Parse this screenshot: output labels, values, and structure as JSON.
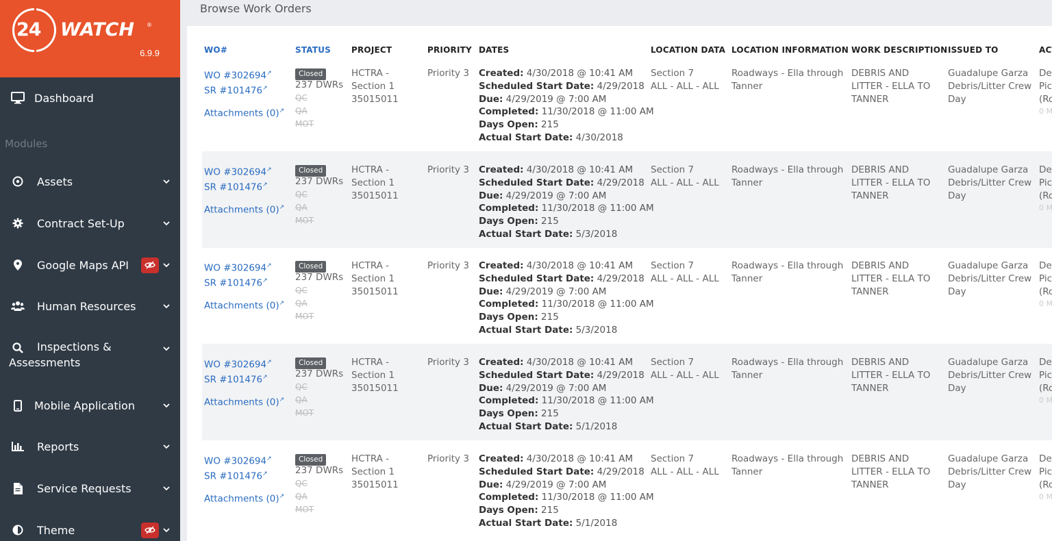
{
  "brand": {
    "logo_num": "24",
    "logo_word": "WATCH",
    "logo_reg": "®",
    "version": "6.9.9"
  },
  "sidebar": {
    "dashboard": "Dashboard",
    "modules_label": "Modules",
    "items": [
      {
        "label": "Assets",
        "icon": "compass-icon",
        "badge": false
      },
      {
        "label": "Contract Set-Up",
        "icon": "gear-icon",
        "badge": false
      },
      {
        "label": "Google Maps API",
        "icon": "map-marker-icon",
        "badge": true
      },
      {
        "label": "Human Resources",
        "icon": "users-icon",
        "badge": false
      },
      {
        "label": "Inspections &",
        "label2": "Assessments",
        "icon": "search-icon",
        "badge": false
      },
      {
        "label": "Mobile Application",
        "icon": "mobile-icon",
        "badge": false
      },
      {
        "label": "Reports",
        "icon": "bar-chart-icon",
        "badge": false
      },
      {
        "label": "Service Requests",
        "icon": "file-icon",
        "badge": false
      },
      {
        "label": "Theme",
        "icon": "contrast-icon",
        "badge": true
      }
    ]
  },
  "page": {
    "title": "Browse Work Orders"
  },
  "table": {
    "headers": {
      "wo": "WO#",
      "status": "STATUS",
      "project": "PROJECT",
      "priority": "PRIORITY",
      "dates": "DATES",
      "location_data": "LOCATION DATA",
      "location_info": "LOCATION INFORMATION",
      "work_desc": "WORK DESCRIPTION",
      "issued_to": "ISSUED TO",
      "actions": "ACT"
    },
    "rows": [
      {
        "wo": "WO #302694",
        "sr": "SR #101476",
        "attachments": "Attachments (0)",
        "status": "Closed",
        "dwrs": "237 DWRs",
        "qc": "QC",
        "qa": "QA",
        "mot": "MOT",
        "project1": "HCTRA -",
        "project2": "Section 1",
        "project3": "35015011",
        "priority": "Priority 3",
        "created_label": "Created:",
        "created": " 4/30/2018 @ 10:41 AM",
        "sched_label": "Scheduled Start Date:",
        "sched": " 4/29/2018",
        "due_label": "Due:",
        "due": " 4/29/2019 @ 7:00 AM",
        "completed_label": "Completed:",
        "completed": " 11/30/2018 @ 11:00 AM",
        "days_label": "Days Open:",
        "days": " 215",
        "actual_label": "Actual Start Date:",
        "actual": " 4/30/2018",
        "loc1": "Section 7",
        "loc2": "ALL - ALL - ALL",
        "info1": "Roadways - Ella through",
        "info2": "Tanner",
        "desc1": "DEBRIS AND",
        "desc2": "LITTER - ELLA TO",
        "desc3": "TANNER",
        "issued1": "Guadalupe Garza",
        "issued2": "Debris/Litter Crew",
        "issued3": "Day",
        "act1": "De",
        "act2": "Pic",
        "act3": "(Ro",
        "act4": "0 M"
      },
      {
        "wo": "WO #302694",
        "sr": "SR #101476",
        "attachments": "Attachments (0)",
        "status": "Closed",
        "dwrs": "237 DWRs",
        "qc": "QC",
        "qa": "QA",
        "mot": "MOT",
        "project1": "HCTRA -",
        "project2": "Section 1",
        "project3": "35015011",
        "priority": "Priority 3",
        "created_label": "Created:",
        "created": " 4/30/2018 @ 10:41 AM",
        "sched_label": "Scheduled Start Date:",
        "sched": " 4/29/2018",
        "due_label": "Due:",
        "due": " 4/29/2019 @ 7:00 AM",
        "completed_label": "Completed:",
        "completed": " 11/30/2018 @ 11:00 AM",
        "days_label": "Days Open:",
        "days": " 215",
        "actual_label": "Actual Start Date:",
        "actual": " 5/3/2018",
        "loc1": "Section 7",
        "loc2": "ALL - ALL - ALL",
        "info1": "Roadways - Ella through",
        "info2": "Tanner",
        "desc1": "DEBRIS AND",
        "desc2": "LITTER - ELLA TO",
        "desc3": "TANNER",
        "issued1": "Guadalupe Garza",
        "issued2": "Debris/Litter Crew",
        "issued3": "Day",
        "act1": "De",
        "act2": "Pic",
        "act3": "(Ro",
        "act4": "0 M"
      },
      {
        "wo": "WO #302694",
        "sr": "SR #101476",
        "attachments": "Attachments (0)",
        "status": "Closed",
        "dwrs": "237 DWRs",
        "qc": "QC",
        "qa": "QA",
        "mot": "MOT",
        "project1": "HCTRA -",
        "project2": "Section 1",
        "project3": "35015011",
        "priority": "Priority 3",
        "created_label": "Created:",
        "created": " 4/30/2018 @ 10:41 AM",
        "sched_label": "Scheduled Start Date:",
        "sched": " 4/29/2018",
        "due_label": "Due:",
        "due": " 4/29/2019 @ 7:00 AM",
        "completed_label": "Completed:",
        "completed": " 11/30/2018 @ 11:00 AM",
        "days_label": "Days Open:",
        "days": " 215",
        "actual_label": "Actual Start Date:",
        "actual": " 5/3/2018",
        "loc1": "Section 7",
        "loc2": "ALL - ALL - ALL",
        "info1": "Roadways - Ella through",
        "info2": "Tanner",
        "desc1": "DEBRIS AND",
        "desc2": "LITTER - ELLA TO",
        "desc3": "TANNER",
        "issued1": "Guadalupe Garza",
        "issued2": "Debris/Litter Crew",
        "issued3": "Day",
        "act1": "De",
        "act2": "Pic",
        "act3": "(Ro",
        "act4": "0 M"
      },
      {
        "wo": "WO #302694",
        "sr": "SR #101476",
        "attachments": "Attachments (0)",
        "status": "Closed",
        "dwrs": "237 DWRs",
        "qc": "QC",
        "qa": "QA",
        "mot": "MOT",
        "project1": "HCTRA -",
        "project2": "Section 1",
        "project3": "35015011",
        "priority": "Priority 3",
        "created_label": "Created:",
        "created": " 4/30/2018 @ 10:41 AM",
        "sched_label": "Scheduled Start Date:",
        "sched": " 4/29/2018",
        "due_label": "Due:",
        "due": " 4/29/2019 @ 7:00 AM",
        "completed_label": "Completed:",
        "completed": " 11/30/2018 @ 11:00 AM",
        "days_label": "Days Open:",
        "days": " 215",
        "actual_label": "Actual Start Date:",
        "actual": " 5/1/2018",
        "loc1": "Section 7",
        "loc2": "ALL - ALL - ALL",
        "info1": "Roadways - Ella through",
        "info2": "Tanner",
        "desc1": "DEBRIS AND",
        "desc2": "LITTER - ELLA TO",
        "desc3": "TANNER",
        "issued1": "Guadalupe Garza",
        "issued2": "Debris/Litter Crew",
        "issued3": "Day",
        "act1": "De",
        "act2": "Pic",
        "act3": "(Ro",
        "act4": "0 M"
      },
      {
        "wo": "WO #302694",
        "sr": "SR #101476",
        "attachments": "Attachments (0)",
        "status": "Closed",
        "dwrs": "237 DWRs",
        "qc": "QC",
        "qa": "QA",
        "mot": "MOT",
        "project1": "HCTRA -",
        "project2": "Section 1",
        "project3": "35015011",
        "priority": "Priority 3",
        "created_label": "Created:",
        "created": " 4/30/2018 @ 10:41 AM",
        "sched_label": "Scheduled Start Date:",
        "sched": " 4/29/2018",
        "due_label": "Due:",
        "due": " 4/29/2019 @ 7:00 AM",
        "completed_label": "Completed:",
        "completed": " 11/30/2018 @ 11:00 AM",
        "days_label": "Days Open:",
        "days": " 215",
        "actual_label": "Actual Start Date:",
        "actual": " 5/1/2018",
        "loc1": "Section 7",
        "loc2": "ALL - ALL - ALL",
        "info1": "Roadways - Ella through",
        "info2": "Tanner",
        "desc1": "DEBRIS AND",
        "desc2": "LITTER - ELLA TO",
        "desc3": "TANNER",
        "issued1": "Guadalupe Garza",
        "issued2": "Debris/Litter Crew",
        "issued3": "Day",
        "act1": "De",
        "act2": "Pic",
        "act3": "(Ro",
        "act4": "0 M"
      }
    ]
  }
}
